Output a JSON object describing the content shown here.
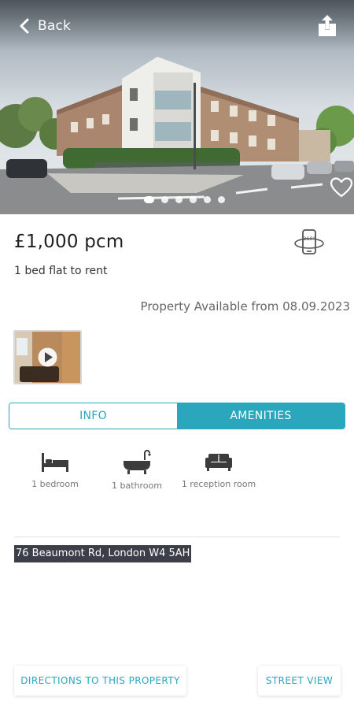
{
  "header": {
    "back_label": "Back"
  },
  "gallery": {
    "photo_count": 6,
    "active_index": 0
  },
  "listing": {
    "price": "£1,000 pcm",
    "subtitle": "1 bed flat to rent",
    "availability": "Property Available from 08.09.2023"
  },
  "tabs": [
    {
      "label": "INFO",
      "active": false
    },
    {
      "label": "AMENITIES",
      "active": true
    }
  ],
  "amenities": [
    {
      "icon": "bed-icon",
      "label": "1 bedroom"
    },
    {
      "icon": "bathtub-icon",
      "label": "1 bathroom"
    },
    {
      "icon": "sofa-icon",
      "label": "1 reception room"
    }
  ],
  "address": "76 Beaumont Rd, London W4 5AH",
  "actions": {
    "directions_label": "DIRECTIONS TO THIS PROPERTY",
    "street_view_label": "STREET VIEW"
  },
  "colors": {
    "accent": "#2aa6bd",
    "address_highlight": "#3c3f4a"
  }
}
